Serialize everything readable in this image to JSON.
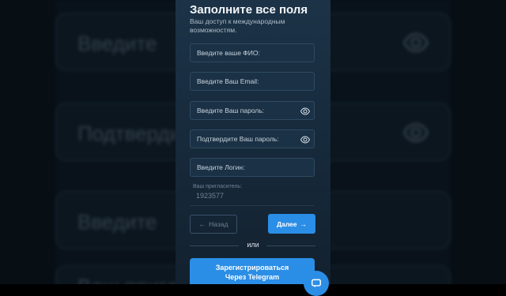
{
  "background": {
    "fields": [
      {
        "label": "Введите",
        "has_eye": true
      },
      {
        "label": "Подтвердите пароль:",
        "has_eye": true
      },
      {
        "label": "Введите",
        "has_eye": false
      },
      {
        "label": "Ваш приглас",
        "has_eye": false
      }
    ]
  },
  "form": {
    "title": "Заполните все поля",
    "subtitle": "Ваш доступ к международным возможностям.",
    "fields": [
      {
        "placeholder": "Введите ваше ФИО:",
        "has_eye": false
      },
      {
        "placeholder": "Введите Ваш Email:",
        "has_eye": false
      },
      {
        "placeholder": "Введите Ваш пароль:",
        "has_eye": true
      },
      {
        "placeholder": "Подтвердите Ваш пароль:",
        "has_eye": true
      },
      {
        "placeholder": "Введите Логин:",
        "has_eye": false
      }
    ],
    "referrer_label": "Ваш пригласитель:",
    "referrer_value": "1923577",
    "back_label": "Назад",
    "next_label": "Далее",
    "or_label": "или",
    "telegram_label_line1": "Зарегистрироваться",
    "telegram_label_line2": "Через Telegram"
  },
  "colors": {
    "accent": "#2b8ee6",
    "panel": "#1c3347",
    "field_border": "#2f4a61"
  },
  "icons": {
    "eye": "eye-icon",
    "back_arrow": "arrow-left-icon",
    "next_arrow": "arrow-right-icon",
    "chat": "chat-icon"
  }
}
